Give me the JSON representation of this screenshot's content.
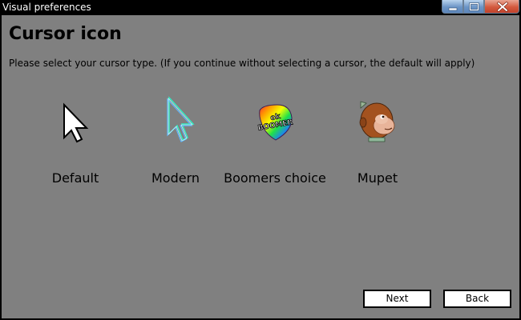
{
  "window": {
    "title": "Visual preferences",
    "controls": [
      "minimize-icon",
      "maximize-icon",
      "close-icon"
    ]
  },
  "page": {
    "heading": "Cursor icon",
    "instructions": "Please select your cursor type. (If you continue without selecting a cursor, the default will apply)"
  },
  "cursor_options": [
    {
      "label": "Default",
      "icon": "arrow-cursor-icon"
    },
    {
      "label": "Modern",
      "icon": "outline-arrow-cursor-icon"
    },
    {
      "label": "Boomers choice",
      "icon": "ok-boomer-cursor-icon"
    },
    {
      "label": "Mupet",
      "icon": "monkey-cursor-icon"
    }
  ],
  "buttons": {
    "next": "Next",
    "back": "Back"
  },
  "colors": {
    "background": "#808080",
    "titlebar": "#000000"
  }
}
